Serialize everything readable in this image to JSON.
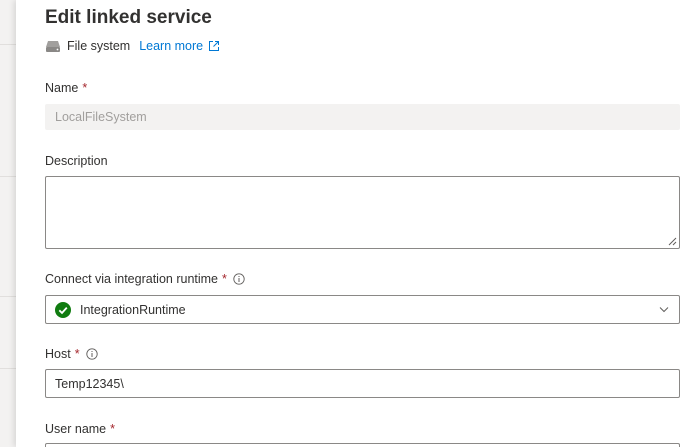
{
  "header": {
    "title": "Edit linked service",
    "type_label": "File system",
    "learn_more": "Learn more"
  },
  "form": {
    "name": {
      "label": "Name",
      "required_mark": "*",
      "value": "LocalFileSystem"
    },
    "description": {
      "label": "Description",
      "value": ""
    },
    "integration_runtime": {
      "label": "Connect via integration runtime",
      "required_mark": "*",
      "value": "IntegrationRuntime",
      "status": "running"
    },
    "host": {
      "label": "Host",
      "required_mark": "*",
      "value": "Temp12345\\"
    },
    "user_name": {
      "label": "User name",
      "required_mark": "*",
      "value": ""
    }
  },
  "icons": {
    "type_icon": "drive-icon",
    "learn_more_icon": "open-in-new-window-icon",
    "info_icon": "info-icon",
    "status_icon": "check-circle-icon",
    "dropdown_icon": "chevron-down-icon"
  },
  "colors": {
    "accent": "#0078d4",
    "required": "#a4262c",
    "success": "#107c10",
    "text": "#323130",
    "disabled_bg": "#f3f2f1",
    "disabled_text": "#a19f9d",
    "border": "#8a8886"
  }
}
